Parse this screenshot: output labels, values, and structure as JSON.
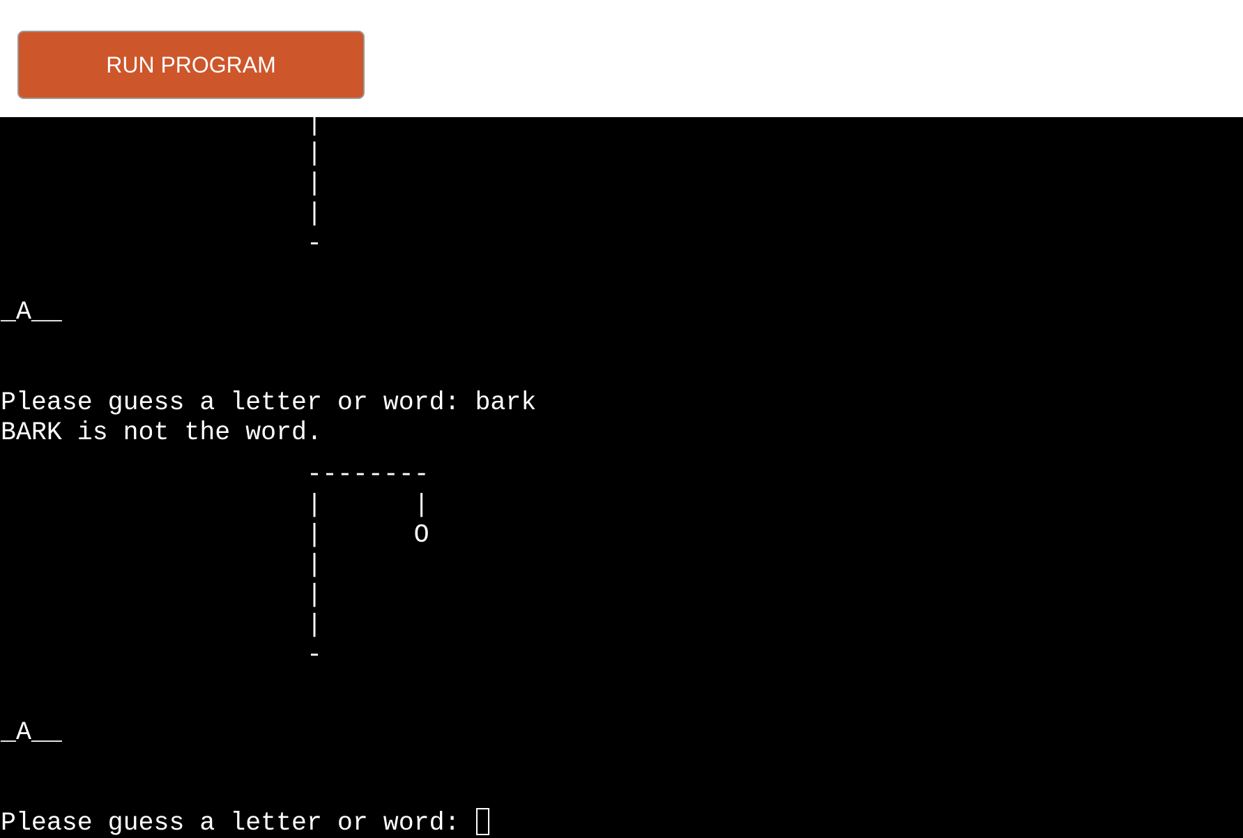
{
  "toolbar": {
    "run_label": "RUN PROGRAM"
  },
  "terminal": {
    "lines": [
      "                    |",
      "                    |",
      "                    |",
      "                    |",
      "                    -",
      "",
      "",
      "_A__",
      "",
      "",
      "Please guess a letter or word: bark",
      "BARK is not the word.",
      "",
      "                    --------",
      "                    |      |",
      "                    |      O",
      "                    |",
      "                    |",
      "                    |",
      "                    -",
      "",
      "",
      "_A__",
      "",
      "",
      "Please guess a letter or word: "
    ]
  },
  "colors": {
    "run_button_bg": "#cd562b",
    "terminal_bg": "#000000",
    "terminal_text": "#ffffff"
  }
}
